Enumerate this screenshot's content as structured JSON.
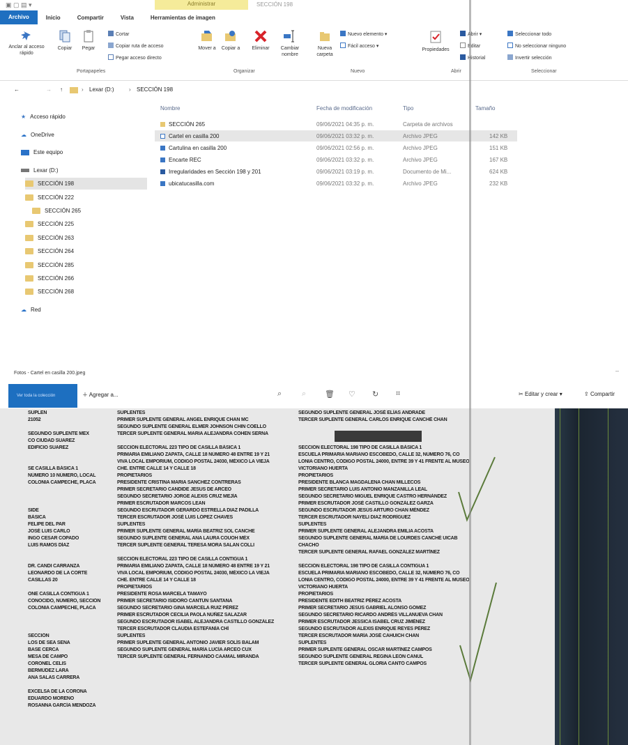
{
  "titlebar": {
    "tool_tab": "Administrar",
    "title": "SECCIÓN 198"
  },
  "tabs": [
    "Archivo",
    "Inicio",
    "Compartir",
    "Vista",
    "Herramientas de imagen"
  ],
  "ribbon": {
    "pin": "Anclar al acceso rápido",
    "copy": "Copiar",
    "paste": "Pegar",
    "cut": "Cortar",
    "copy_path": "Copiar ruta de acceso",
    "paste_shortcut": "Pegar acceso directo",
    "group_clipboard": "Portapapeles",
    "move_to": "Mover a",
    "copy_to": "Copiar a",
    "delete": "Eliminar",
    "rename": "Cambiar nombre",
    "group_organize": "Organizar",
    "new_folder": "Nueva carpeta",
    "new_item": "Nuevo elemento",
    "easy_access": "Fácil acceso",
    "group_new": "Nuevo",
    "properties": "Propiedades",
    "open": "Abrir",
    "edit": "Editar",
    "history": "Historial",
    "group_open": "Abrir",
    "select_all": "Seleccionar todo",
    "select_none": "No seleccionar ninguno",
    "invert_selection": "Invertir selección",
    "group_select": "Seleccionar"
  },
  "address": {
    "drive": "Lexar (D:)",
    "folder": "SECCIÓN 198"
  },
  "nav": {
    "quick_access": "Acceso rápido",
    "onedrive": "OneDrive",
    "this_pc": "Este equipo",
    "drive": "Lexar (D:)",
    "folders": [
      "SECCIÓN 198",
      "SECCIÓN 222",
      "SECCIÓN 265",
      "SECCIÓN 225",
      "SECCIÓN 263",
      "SECCIÓN 264",
      "SECCIÓN 285",
      "SECCIÓN 266",
      "SECCIÓN 268"
    ],
    "network": "Red"
  },
  "columns": {
    "name": "Nombre",
    "date": "Fecha de modificación",
    "type": "Tipo",
    "size": "Tamaño"
  },
  "files": [
    {
      "name": "SECCIÓN 265",
      "date": "09/06/2021 04:35 p. m.",
      "type": "Carpeta de archivos",
      "size": ""
    },
    {
      "name": "Cartel en casilla 200",
      "date": "09/06/2021 03:32 p. m.",
      "type": "Archivo JPEG",
      "size": "142 KB"
    },
    {
      "name": "Cartulina en casilla 200",
      "date": "09/06/2021 02:56 p. m.",
      "type": "Archivo JPEG",
      "size": "151 KB"
    },
    {
      "name": "Encarte REC",
      "date": "09/06/2021 03:32 p. m.",
      "type": "Archivo JPEG",
      "size": "167 KB"
    },
    {
      "name": "Irregularidades en Sección 198 y 201",
      "date": "09/06/2021 03:19 p. m.",
      "type": "Documento de Mi...",
      "size": "624 KB"
    },
    {
      "name": "ubicatucasilla.com",
      "date": "09/06/2021 03:32 p. m.",
      "type": "Archivo JPEG",
      "size": "232 KB"
    }
  ],
  "viewer": {
    "title": "Fotos - Cartel en casilla 200.jpeg",
    "collection": "Ver toda la colección",
    "add_to": "Agregar a...",
    "edit_create": "Editar y crear",
    "share": "Compartir"
  },
  "document": {
    "col_a": [
      "SUPLEN",
      "21052",
      "",
      "SEGUNDO SUPLENTE MEX",
      "CO CIUDAD SUAREZ",
      "EDIFICIO SUAREZ",
      "",
      "",
      "SE CASILLA BÁSICA 1",
      "NÚMERO 10 NÚMERO, LOCAL",
      "COLONIA CAMPECHE, PLACA",
      "",
      "",
      "",
      "SIDE",
      "BÁSICA",
      "FELIPE DEL PAR",
      "JOSÉ LUIS CARLO",
      "INGO CESAR COPADO",
      "LUIS RAMOS DÍAZ",
      "",
      "",
      "DR. CANDI CARRANZA",
      "LEONARDO DE LA CORTE",
      "CASILLAS 20",
      "",
      "ONE CASILLA CONTIGUA 1",
      "CONOCIDO, NÚMERO, SECCIÓN",
      "COLONIA CAMPECHE, PLACA",
      "",
      "",
      "",
      "SECCIÓN",
      "LOS DE SEA SENA",
      "BASE CERCA",
      "MESA DE CAMPO",
      "CORONEL CELIS",
      "BERMÚDEZ LARA",
      "ANA SALAS CARRERA",
      "",
      "EXCELSA DE LA CORONA",
      "EDUARDO MORENO",
      "ROSANNA GARCÍA MENDOZA"
    ],
    "col_b": [
      "SUPLENTES",
      "PRIMER SUPLENTE GENERAL   ANGEL ENRIQUE CHAN MC",
      "SEGUNDO SUPLENTE GENERAL   ELMER JOHNSON CHIN COELLO",
      "TERCER SUPLENTE GENERAL   MARIA ALEJANDRA COHEN SERNA",
      "",
      "SECCIÓN ELECTORAL   223   TIPO DE CASILLA   BÁSICA 1",
      "PRIMARIA EMILIANO ZAPATA, CALLE 18 NÚMERO 48 ENTRE 19 Y 21",
      "VIVA LOCAL EMPORIUM, CÓDIGO POSTAL 24030, MÉXICO LA VIEJA",
      "CHE. ENTRE CALLE 14 Y CALLE 18",
      "PROPIETARIOS",
      "PRESIDENTE   CRISTINA MARIA SANCHEZ CONTRERAS",
      "PRIMER SECRETARIO   CANDIDE JESUS DE ARCEO",
      "SEGUNDO SECRETARIO   JORGE ALEXIS CRUZ MEJÍA",
      "PRIMER ESCRUTADOR   MARCOS LEAN",
      "SEGUNDO ESCRUTADOR   GERARDO ESTRELLA DIAZ PADILLA",
      "TERCER ESCRUTADOR   JOSÉ LUIS LÓPEZ CHAVES",
      "SUPLENTES",
      "PRIMER SUPLENTE GENERAL   MARÍA BEATRIZ SOL CANCHE",
      "SEGUNDO SUPLENTE GENERAL   ANA LAURA COUOH MÉX",
      "TERCER SUPLENTE GENERAL   TERESA MORA SALAN COLLI",
      "",
      "SECCIÓN ELECTORAL   223   TIPO DE CASILLA   CONTIGUA 1",
      "PRIMARIA EMILIANO ZAPATA, CALLE 18 NÚMERO 48 ENTRE 19 Y 21",
      "VIVA LOCAL EMPORIUM, CÓDIGO POSTAL 24030, MÉXICO LA VIEJA",
      "CHE. ENTRE CALLE 14 Y CALLE 18",
      "PROPIETARIOS",
      "PRESIDENTE   ROSA MARCELA TAMAYO",
      "PRIMER SECRETARIO   ISIDORO CANTÚN SANTANA",
      "SEGUNDO SECRETARIO   GINA MARCELA RUIZ PÉREZ",
      "PRIMER ESCRUTADOR   CECILIA PAOLA NÚÑEZ SALAZAR",
      "SEGUNDO ESCRUTADOR   ISABEL ALEJANDRA CASTILLO GONZÁLEZ",
      "TERCER ESCRUTADOR   CLAUDIA ESTEFANÍA CHÍ",
      "SUPLENTES",
      "PRIMER SUPLENTE GENERAL   ANTONIO JAVIER SOLÍS BALAM",
      "SEGUNDO SUPLENTE GENERAL   MARÍA LUCÍA ARCEO CUX",
      "TERCER SUPLENTE GENERAL   FERNANDO CAAMAL MIRANDA"
    ],
    "col_c": [
      "SEGUNDO SUPLENTE GENERAL   JOSÉ ELÍAS ANDRADE",
      "TERCER SUPLENTE GENERAL   CARLOS ENRIQUE CANCHÉ CHAN",
      "",
      "",
      "",
      "SECCIÓN ELECTORAL   198   TIPO DE CASILLA   BÁSICA 1",
      "ESCUELA PRIMARIA MARIANO ESCOBEDO, CALLE 32, NÚMERO 76, CO",
      "LONIA CENTRO, CÓDIGO POSTAL 24000, ENTRE 39 Y 41 FRENTE AL MUSEO",
      "VICTORIANO HUERTA",
      "PROPIETARIOS",
      "PRESIDENTE   BLANCA MAGDALENA CHAN MILLECOS",
      "PRIMER SECRETARIO   LUIS ANTONIO MANZANILLA LEAL",
      "SEGUNDO SECRETARIO   MIGUEL ENRIQUE CASTRO HERNÁNDEZ",
      "PRIMER ESCRUTADOR   JOSÉ CASTILLO GONZÁLEZ GARZA",
      "SEGUNDO ESCRUTADOR   JESÚS ARTURO CHAN MÉNDEZ",
      "TERCER ESCRUTADOR   NAYELI DIAZ RODRÍGUEZ",
      "SUPLENTES",
      "PRIMER SUPLENTE GENERAL   ALEJANDRA EMILIA ACOSTA",
      "SEGUNDO SUPLENTE GENERAL   MARÍA DE LOURDES CANCHÉ UICAB",
      "CHACHO",
      "TERCER SUPLENTE GENERAL   RAFAEL GONZÁLEZ MARTÍNEZ",
      "",
      "SECCIÓN ELECTORAL   198   TIPO DE CASILLA   CONTIGUA 1",
      "ESCUELA PRIMARIA MARIANO ESCOBEDO, CALLE 32, NÚMERO 76, CO",
      "LONIA CENTRO, CÓDIGO POSTAL 24000, ENTRE 39 Y 41 FRENTE AL MUSEO",
      "VICTORIANO HUERTA",
      "PROPIETARIOS",
      "PRESIDENTE   EDITH BEATRIZ PÉREZ ACOSTA",
      "PRIMER SECRETARIO   JESÚS GABRIEL ALONSO GÓMEZ",
      "SEGUNDO SECRETARIO   RICARDO ANDRÉS VILLANUEVA CHAN",
      "PRIMER ESCRUTADOR   JESSICA ISABEL CRUZ JIMÉNEZ",
      "SEGUNDO ESCRUTADOR   ALEXIS ENRIQUE REYES PÉREZ",
      "TERCER ESCRUTADOR   MARÍA JOSÉ CAHUICH CHAN",
      "SUPLENTES",
      "PRIMER SUPLENTE GENERAL   OSCAR MARTÍNEZ CAMPOS",
      "SEGUNDO SUPLENTE GENERAL   REGINA LEÓN CANUL",
      "TERCER SUPLENTE GENERAL   GLORIA CANTÓ CAMPOS"
    ]
  },
  "colors": {
    "accent": "#1f6fc0",
    "folder": "#e8c872",
    "check_mark": "#5a7a3a"
  }
}
